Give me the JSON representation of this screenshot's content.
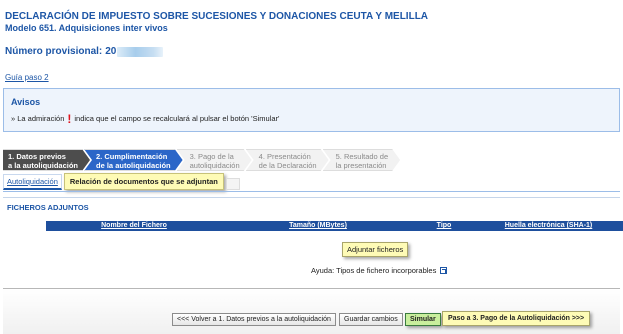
{
  "header": {
    "title_line1": "DECLARACIÓN DE IMPUESTO SOBRE SUCESIONES Y DONACIONES CEUTA Y MELILLA",
    "title_line2": "Modelo 651. Adquisiciones inter vivos",
    "provisional_label": "Número provisional:",
    "provisional_value": "20",
    "guia_link": "Guía paso 2"
  },
  "avisos": {
    "title": "Avisos",
    "text_prefix": "» La admiración",
    "excl": "!",
    "text_suffix": "indica que el campo se recalculará al pulsar el botón 'Simular'"
  },
  "steps": [
    {
      "line1": "1. Datos previos",
      "line2": "a la autoliquidación",
      "state": "done"
    },
    {
      "line1": "2. Cumplimentación",
      "line2": "de la autoliquidación",
      "state": "active"
    },
    {
      "line1": "3. Pago de la",
      "line2": "autoliquidación",
      "state": "inactive"
    },
    {
      "line1": "4. Presentación",
      "line2": "de la Declaración",
      "state": "inactive"
    },
    {
      "line1": "5. Resultado de",
      "line2": "la presentación",
      "state": "inactive"
    }
  ],
  "tabs": {
    "autoliquidacion": "Autoliquidación",
    "relacion": "Relación de documentos que se adjuntan"
  },
  "ficheros": {
    "title": "FICHEROS ADJUNTOS",
    "columns": [
      "Nombre del Fichero",
      "Tamaño (MBytes)",
      "Tipo",
      "Huella electrónica (SHA-1)"
    ],
    "adjuntar_button": "Adjuntar ficheros",
    "ayuda_text": "Ayuda: Tipos de fichero incorporables"
  },
  "buttons": {
    "volver": "<<< Volver a 1. Datos previos a la autoliquidación",
    "guardar": "Guardar cambios",
    "simular": "Simular",
    "paso3": "Paso a 3. Pago de la Autoliquidación >>>"
  },
  "colors": {
    "accent": "#1d56a6",
    "table_header": "#1e4f9d",
    "highlight_yellow": "#fefbb6",
    "simular_green": "#c9ef9d",
    "alert_red": "#e0141e"
  }
}
